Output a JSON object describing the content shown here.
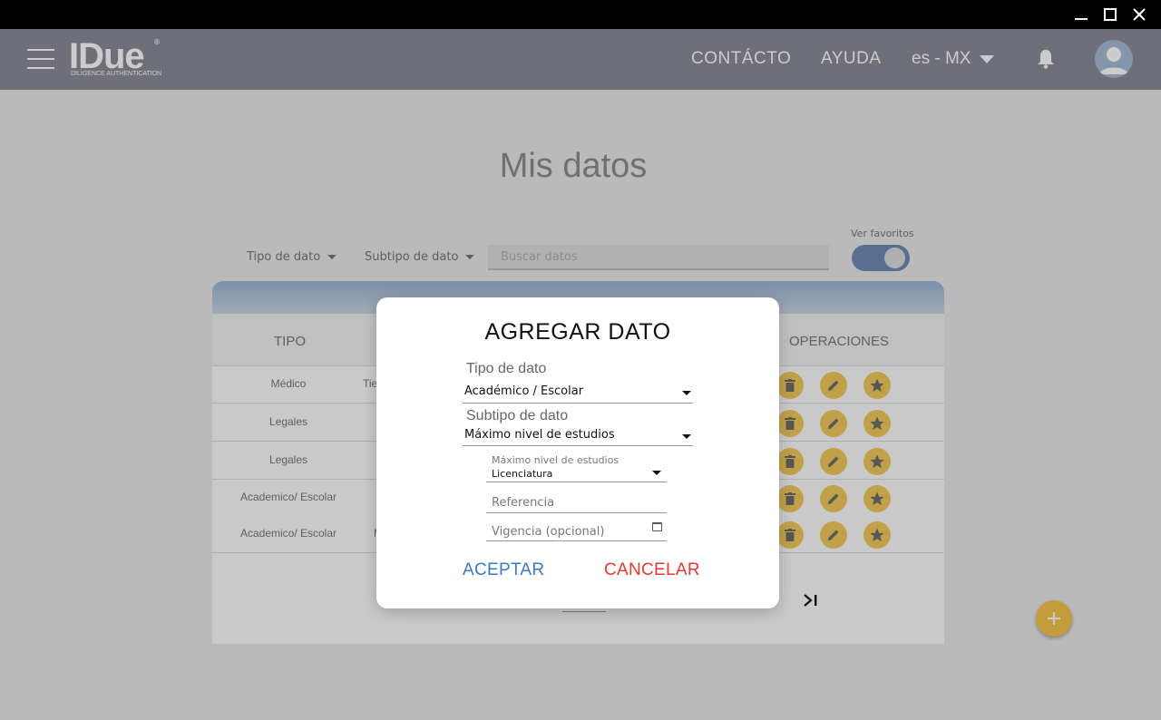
{
  "window": {
    "minimize_icon": "minimize-icon",
    "maximize_icon": "maximize-icon",
    "close_icon": "close-icon"
  },
  "header": {
    "logo": "IDue",
    "logo_tagline": "DILIGENCE AUTHENTICATION",
    "logo_mark": "®",
    "nav": {
      "contacto": "CONTÁCTO",
      "ayuda": "AYUDA"
    },
    "language": "es - MX"
  },
  "page": {
    "title": "Mis datos",
    "filters": {
      "tipo": "Tipo de dato",
      "subtipo": "Subtipo de dato"
    },
    "search": {
      "placeholder": "Buscar datos"
    },
    "favorites": {
      "label": "Ver favoritos",
      "on": true
    }
  },
  "table": {
    "headers": {
      "tipo": "TIPO",
      "operaciones": "OPERACIONES"
    },
    "rows": [
      {
        "tipo": "Médico",
        "sub": "Tie"
      },
      {
        "tipo": "Legales",
        "sub": ""
      },
      {
        "tipo": "Legales",
        "sub": ""
      },
      {
        "tipo": "Academico/ Escolar",
        "sub": ""
      },
      {
        "tipo": "Academico/ Escolar",
        "sub": "M"
      }
    ]
  },
  "modal": {
    "title": "AGREGAR DATO",
    "tipo_label": "Tipo de dato",
    "tipo_value": "Académico / Escolar",
    "subtipo_label": "Subtipo de dato",
    "subtipo_value": "Máximo nivel de estudios",
    "nivel_label": "Máximo nivel de estudios",
    "nivel_value": "Licenciatura",
    "referencia_placeholder": "Referencia",
    "vigencia_placeholder": "Vigencia (opcional)",
    "accept": "ACEPTAR",
    "cancel": "CANCELAR"
  },
  "colors": {
    "header": "#8a8b97",
    "accent_blue": "#3b7ac2",
    "cancel_red": "#e53935",
    "op_button": "#f1c95c",
    "toggle": "#6e8bb4"
  }
}
